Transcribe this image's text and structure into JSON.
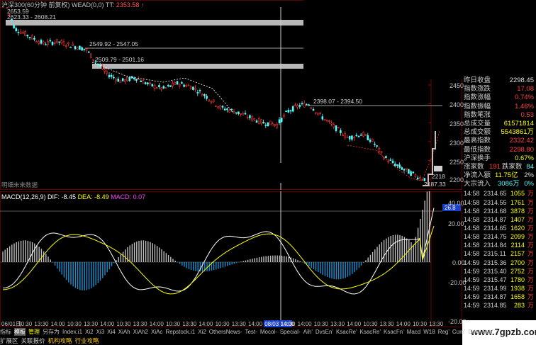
{
  "header": {
    "title_left": "沪深300(60分钟 前复权) WEAD(0,0) TT: ",
    "title_value": "2353.58",
    "title_arrow": "↑"
  },
  "main_chart": {
    "y_labels": [
      "2450",
      "2400",
      "2350",
      "2300",
      "2250",
      "2200"
    ],
    "level_high": "2653.59",
    "level_low": "2187.33",
    "band1": "2623.33 - 2608.21",
    "band2": "2549.92 - 2547.05",
    "band3": "2509.79 - 2501.16",
    "band4": "2398.07 - 2394.50",
    "right_level": "2218",
    "footer_note": "明细未来数据"
  },
  "macd": {
    "title": "MACD(12,26,9) DIF: -8.45 DEA: -8.49 MACD: 0.07",
    "title_dif": "MACD(12,26,9) DIF: -8.45",
    "title_dea": "DEA: -8.49",
    "title_macd": "MACD: 0.07",
    "y_labels": [
      "40.00",
      "20.00",
      "0.00",
      "-20.00"
    ],
    "right_value": "26.8",
    "zero_label": "0.00"
  },
  "x_axis": {
    "labels": [
      "06/01日",
      "10:30",
      "13:30",
      "14:00",
      "10:30",
      "13:30",
      "14:00",
      "10:30",
      "13:30",
      "14:00",
      "10:30",
      "13:30",
      "14:00",
      "10:30",
      "13:30",
      "14:00",
      "08/03 14:00",
      "13:30",
      "14:00",
      "10:30",
      "13:30",
      "14:00",
      "10:30",
      "13:30",
      "14:00",
      "10:30",
      "13:30"
    ],
    "highlight": "08/03 14:00"
  },
  "quote_panel": {
    "rows": [
      {
        "label": "昨日收盘",
        "value": "2298.45",
        "color": "#e0e0e0"
      },
      {
        "label": "指数涨跌",
        "value": "17.08",
        "color": "#ff4040"
      },
      {
        "label": "指数涨幅",
        "value": "0.74%",
        "color": "#ff4040"
      },
      {
        "label": "指数振幅",
        "value": "1.46%",
        "color": "#ff4040"
      },
      {
        "label": "指数笔涨",
        "value": "0.53",
        "color": "#ff4040"
      },
      {
        "label": "总成交量",
        "value": "61571814",
        "color": "#ffff00"
      },
      {
        "label": "总成交额",
        "value": "5543861万",
        "color": "#ffff00"
      },
      {
        "label": "最高指数",
        "value": "2332.42",
        "color": "#ff4040"
      },
      {
        "label": "最低指数",
        "value": "2298.80",
        "color": "#ff4040"
      },
      {
        "label": "沪深换手",
        "value": "0.67%",
        "color": "#ffff00"
      }
    ],
    "updown_label1": "涨家数",
    "updown_v1": "191",
    "updown_label2": "跌家数",
    "updown_v2": "84",
    "inflow_label": "净流入额",
    "inflow_value": "11.75亿",
    "inflow_pct": "2%",
    "big_label": "大宗流入",
    "big_value": "3086万",
    "big_pct": "0%"
  },
  "ticks": [
    {
      "t": "14:58",
      "p": "2314.65",
      "q": "1055",
      "d": "万"
    },
    {
      "t": "14:58",
      "p": "2314.55",
      "q": "1761",
      "d": "万"
    },
    {
      "t": "14:58",
      "p": "2314.68",
      "q": "3878",
      "d": "万"
    },
    {
      "t": "14:58",
      "p": "2314.87",
      "q": "1407",
      "d": "万"
    },
    {
      "t": "14:58",
      "p": "2314.65",
      "q": "1620",
      "d": "万"
    },
    {
      "t": "14:58",
      "p": "2314.75",
      "q": "2099",
      "d": "万"
    },
    {
      "t": "14:58",
      "p": "2314.84",
      "q": "2114",
      "d": "万"
    },
    {
      "t": "14:58",
      "p": "2315.11",
      "q": "2157",
      "d": "万"
    },
    {
      "t": "14:59",
      "p": "2315.36",
      "q": "2700",
      "d": "万"
    },
    {
      "t": "14:59",
      "p": "2315.40",
      "q": "2752",
      "d": "万"
    },
    {
      "t": "14:59",
      "p": "2315.47",
      "q": "1780",
      "d": "万"
    },
    {
      "t": "14:59",
      "p": "2314.99",
      "q": "1938",
      "d": "万"
    },
    {
      "t": "14:59",
      "p": "2314.87",
      "q": "1658",
      "d": "万"
    },
    {
      "t": "14:59",
      "p": "2314.85",
      "q": "283",
      "d": "万"
    }
  ],
  "toolbar": {
    "items": [
      "指标",
      "模板",
      "管理",
      "另存为",
      "Index.i1",
      "Xi2",
      "Xi3",
      "Xi4",
      "XiAh",
      "XiAh2",
      "XiAc",
      "Repstock.i1",
      "Xi2",
      "OthersNews-",
      "Test-",
      "Mocol-",
      "Special-",
      "Aih'",
      "DvsEn'",
      "KsacRe'",
      "KsacRe'",
      "KsacFn'",
      "Macd",
      "W18",
      "Reg'",
      "Cum'",
      "Ddx'",
      "Sup'"
    ]
  },
  "bottom": {
    "items": [
      "扩展区",
      "关联报价",
      "机构攻略",
      "行业攻略"
    ]
  },
  "watermark": "www.7gpzb.com",
  "colors": {
    "up": "#ff3232",
    "down": "#54fcfc",
    "dif": "#ffffff",
    "dea": "#ffff00",
    "macd_bar_pos": "#c0c0c0",
    "macd_bar_neg": "#1a8fd0"
  }
}
